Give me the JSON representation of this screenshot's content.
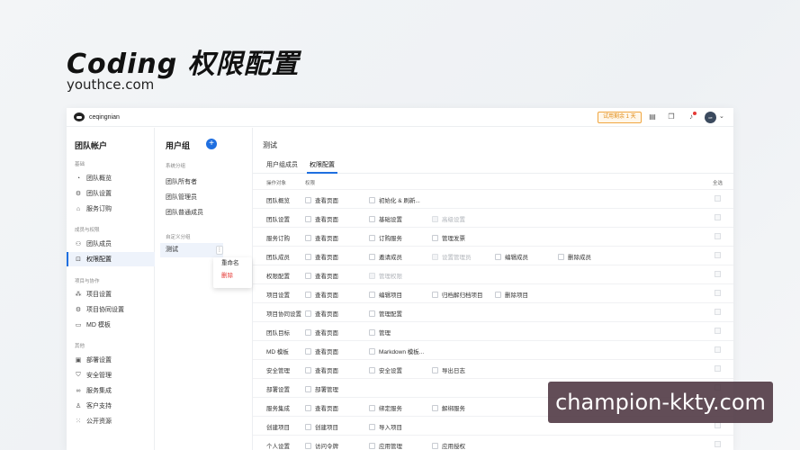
{
  "hero": {
    "title": "Coding 权限配置",
    "subtitle": "youthce.com"
  },
  "topbar": {
    "brand": "ceqingnian",
    "trial": "试用剩余 1 天",
    "avatar": "ce"
  },
  "sidebar": {
    "title": "团队帐户",
    "groups": [
      {
        "label": "基础",
        "items": [
          "团队概览",
          "团队设置",
          "服务订购"
        ]
      },
      {
        "label": "成员与权限",
        "items": [
          "团队成员",
          "权限配置"
        ]
      },
      {
        "label": "项目与协作",
        "items": [
          "项目设置",
          "项目协同设置",
          "MD 模板"
        ]
      },
      {
        "label": "其他",
        "items": [
          "部署设置",
          "安全管理",
          "服务集成",
          "客户支持",
          "公开资源"
        ]
      }
    ]
  },
  "groups_panel": {
    "title": "用户组",
    "system_label": "系统分组",
    "system_items": [
      "团队所有者",
      "团队管理员",
      "团队普通成员"
    ],
    "custom_label": "自定义分组",
    "active_item": "测试",
    "menu": [
      "重命名",
      "删除"
    ]
  },
  "main": {
    "title": "测试",
    "tabs": [
      "用户组成员",
      "权限配置"
    ],
    "headers": {
      "target": "操作对象",
      "perm": "权限",
      "all": "全选"
    },
    "rows": [
      {
        "name": "团队概览",
        "perms": [
          "查看页面",
          "初始化 & 刷新..."
        ]
      },
      {
        "name": "团队设置",
        "perms": [
          "查看页面",
          "基础设置",
          "高级设置"
        ]
      },
      {
        "name": "服务订购",
        "perms": [
          "查看页面",
          "订购服务",
          "管理发票"
        ]
      },
      {
        "name": "团队成员",
        "perms": [
          "查看页面",
          "邀请成员",
          "设置管理员",
          "编辑成员",
          "删除成员"
        ]
      },
      {
        "name": "权限配置",
        "perms": [
          "查看页面",
          "管理权限"
        ]
      },
      {
        "name": "项目设置",
        "perms": [
          "查看页面",
          "编辑项目",
          "归档解归档项目",
          "删除项目"
        ]
      },
      {
        "name": "项目协同设置",
        "perms": [
          "查看页面",
          "管理配置"
        ]
      },
      {
        "name": "团队目标",
        "perms": [
          "查看页面",
          "管理"
        ]
      },
      {
        "name": "MD 模板",
        "perms": [
          "查看页面",
          "Markdown 模板..."
        ]
      },
      {
        "name": "安全管理",
        "perms": [
          "查看页面",
          "安全设置",
          "导出日志"
        ]
      },
      {
        "name": "部署设置",
        "perms": [
          "部署管理"
        ]
      },
      {
        "name": "服务集成",
        "perms": [
          "查看页面",
          "绑定服务",
          "解绑服务"
        ]
      },
      {
        "name": "创建项目",
        "perms": [
          "创建项目",
          "导入项目"
        ]
      },
      {
        "name": "个人设置",
        "perms": [
          "访问令牌",
          "应用管理",
          "应用授权"
        ]
      }
    ]
  },
  "watermark": "champion-kkty.com",
  "colors": {
    "accent": "#1f6fe0",
    "danger": "#e53935",
    "trial": "#e08a13"
  }
}
